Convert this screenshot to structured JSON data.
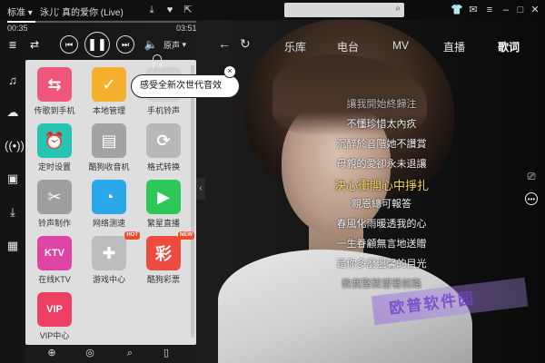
{
  "titlebar": {
    "quality": "标准",
    "artist": "泳儿",
    "song": "真的爱你 (Live)",
    "search_placeholder": "",
    "icons": [
      "download-icon",
      "heart-icon",
      "share-icon",
      "skin-icon",
      "mail-icon",
      "menu-icon",
      "minimize-icon",
      "maximize-icon",
      "close-icon"
    ]
  },
  "progress": {
    "elapsed": "00:35",
    "total": "03:51",
    "fraction": 0.15
  },
  "controls": {
    "sound_effect_label": "原声"
  },
  "nav": {
    "tabs": [
      "乐库",
      "电台",
      "MV",
      "直播",
      "歌词"
    ],
    "active": "歌词"
  },
  "tooltip": {
    "text": "感受全新次世代音效",
    "close": "×"
  },
  "apps": [
    {
      "label": "传歌到手机",
      "color": "#f0557a",
      "glyph": "⇆",
      "badge": ""
    },
    {
      "label": "本地管理",
      "color": "#f5b02e",
      "glyph": "✓",
      "badge": ""
    },
    {
      "label": "手机铃声",
      "color": "#d0d0d0",
      "glyph": "♪",
      "badge": ""
    },
    {
      "label": "定时设置",
      "color": "#27c4b4",
      "glyph": "⏰",
      "badge": ""
    },
    {
      "label": "酷狗收音机",
      "color": "#a3a3a3",
      "glyph": "▤",
      "badge": ""
    },
    {
      "label": "格式转换",
      "color": "#b8b8b8",
      "glyph": "⟳",
      "badge": ""
    },
    {
      "label": "铃声制作",
      "color": "#9e9e9e",
      "glyph": "✂",
      "badge": ""
    },
    {
      "label": "网络测速",
      "color": "#2aa7e8",
      "glyph": "◔",
      "badge": ""
    },
    {
      "label": "繁星直播",
      "color": "#2ec85a",
      "glyph": "▶",
      "badge": ""
    },
    {
      "label": "在线KTV",
      "color": "#e043a6",
      "glyph": "KTV",
      "badge": ""
    },
    {
      "label": "游戏中心",
      "color": "#bdbdbd",
      "glyph": "✚",
      "badge": "HOT"
    },
    {
      "label": "酷狗彩票",
      "color": "#ef4a3e",
      "glyph": "彩",
      "badge": "NEW"
    },
    {
      "label": "VIP中心",
      "color": "#ec3f62",
      "glyph": "VIP",
      "badge": ""
    }
  ],
  "lyrics": [
    {
      "text": "讓我開始終歸注",
      "state": "dim"
    },
    {
      "text": "不懂珍惜太內疚",
      "state": "normal"
    },
    {
      "text": "沉醉於音階她不讚賞",
      "state": "normal"
    },
    {
      "text": "母親的愛卻永未退讓",
      "state": "normal"
    },
    {
      "text": "決心衝開心中掙扎",
      "state": "current"
    },
    {
      "text": "親恩總可報答",
      "state": "normal"
    },
    {
      "text": "春風化雨暖透我的心",
      "state": "normal"
    },
    {
      "text": "一生眷顧無言地送贈",
      "state": "normal"
    },
    {
      "text": "是你多麼溫馨的目光",
      "state": "normal"
    },
    {
      "text": "教我堅毅望著前路",
      "state": "dim"
    }
  ],
  "watermark": "欧普软件园",
  "accent_color": "#f2d35c"
}
